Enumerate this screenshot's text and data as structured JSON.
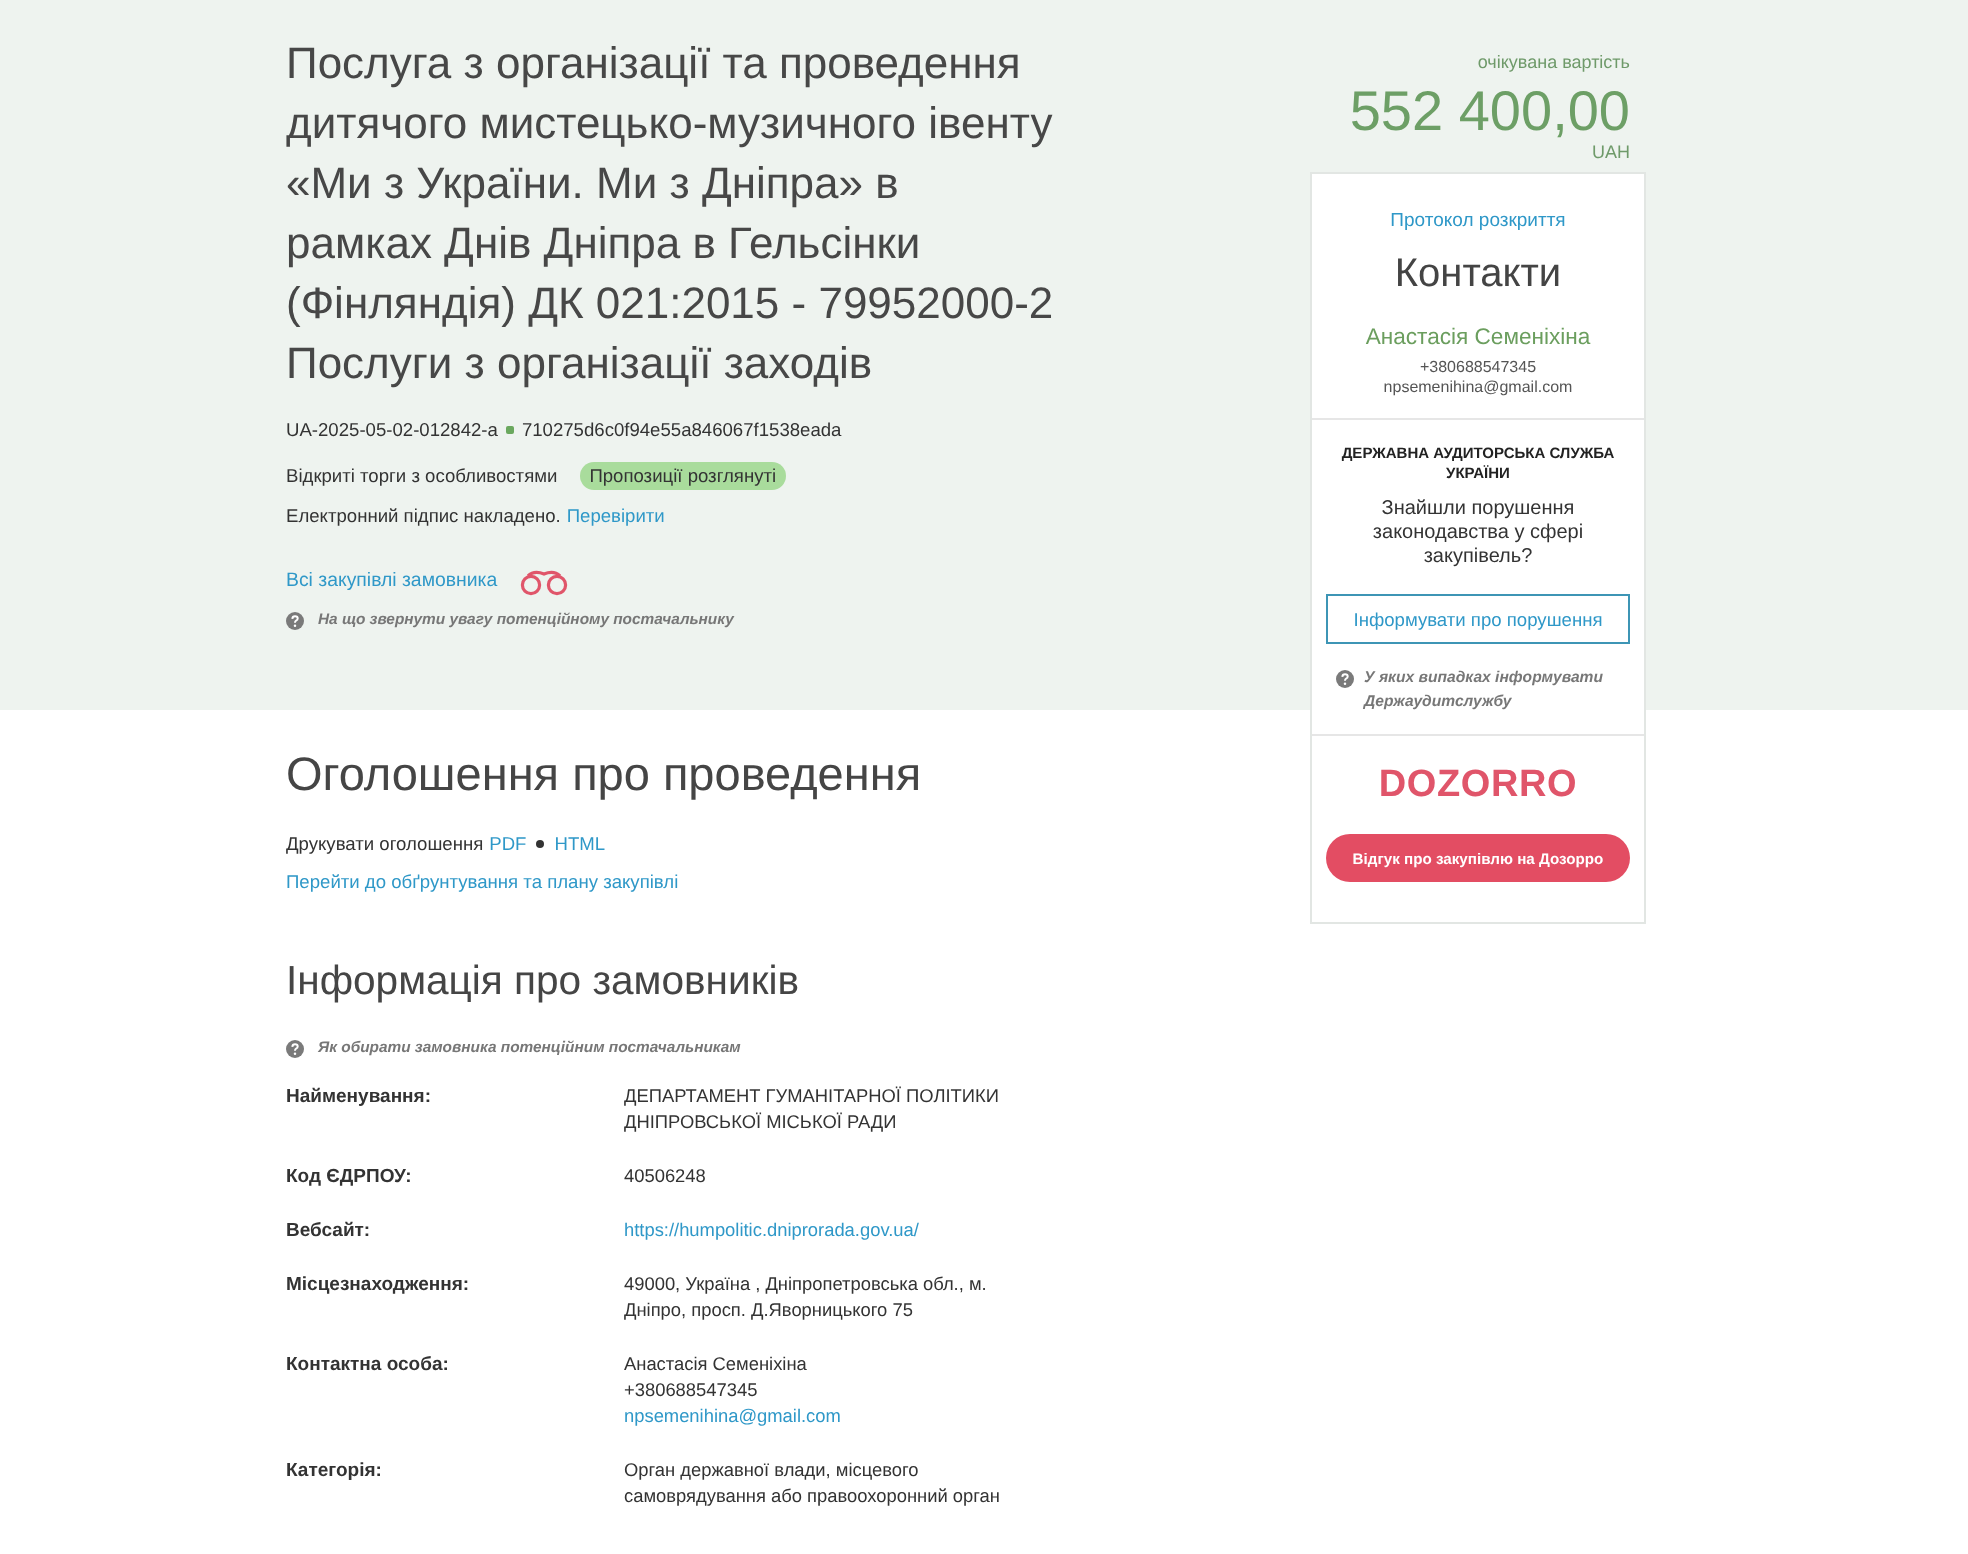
{
  "header": {
    "title": "Послуга з організації та проведення дитячого мистецько-музичного івенту «Ми з України. Ми з Дніпра» в рамках Днів Дніпра в Гельсінки (Фінляндія) ДК 021:2015 - 79952000-2 Послуги з організації заходів",
    "tender_id": "UA-2025-05-02-012842-a",
    "hash": "710275d6c0f94e55a846067f1538eada",
    "procedure": "Відкриті торги з особливостями",
    "status": "Пропозиції розглянуті",
    "signature_text": "Електронний підпис накладено.",
    "signature_link": "Перевірити",
    "buyer_link": "Всі закупівлі замовника",
    "help": "На що звернути увагу потенційному постачальнику"
  },
  "sidebar": {
    "price_label": "очікувана вартість",
    "price": "552 400,00",
    "currency": "UAH",
    "protocol_link": "Протокол розкриття",
    "contacts_title": "Контакти",
    "contact_name": "Анастасія Семеніхіна",
    "contact_phone": "+380688547345",
    "contact_email": "npsemenihina@gmail.com",
    "audit_title": "ДЕРЖАВНА АУДИТОРСЬКА СЛУЖБА УКРАЇНИ",
    "audit_question": "Знайшли порушення законодавства у сфері закупівель?",
    "audit_button": "Інформувати про порушення",
    "audit_help": "У яких випадках інформувати Держаудитслужбу",
    "logo": "DOZORRO",
    "feedback_button": "Відгук про закупівлю на Дозорро"
  },
  "announcement": {
    "title": "Оголошення про проведення",
    "print_label": "Друкувати оголошення",
    "print_links": [
      "PDF",
      "HTML"
    ],
    "plan_link": "Перейти до обґрунтування та плану закупівлі"
  },
  "customers": {
    "title": "Інформація про замовників",
    "help": "Як обирати замовника потенційним постачальникам",
    "rows": [
      {
        "label": "Найменування:",
        "values": [
          {
            "kind": "text",
            "text": "ДЕПАРТАМЕНТ ГУМАНІТАРНОЇ ПОЛІТИКИ ДНІПРОВСЬКОЇ МІСЬКОЇ РАДИ"
          }
        ]
      },
      {
        "label": "Код ЄДРПОУ:",
        "values": [
          {
            "kind": "text",
            "text": "40506248"
          }
        ]
      },
      {
        "label": "Вебсайт:",
        "values": [
          {
            "kind": "link",
            "text": "https://humpolitic.dniprorada.gov.ua/"
          }
        ]
      },
      {
        "label": "Місцезнаходження:",
        "values": [
          {
            "kind": "text",
            "text": "49000, Україна , Дніпропетровська обл., м. Дніпро, просп. Д.Яворницького 75"
          }
        ]
      },
      {
        "label": "Контактна особа:",
        "values": [
          {
            "kind": "text",
            "text": "Анастасія Семеніхіна"
          },
          {
            "kind": "text",
            "text": "+380688547345"
          },
          {
            "kind": "link",
            "text": "npsemenihina@gmail.com"
          }
        ]
      },
      {
        "label": "Категорія:",
        "values": [
          {
            "kind": "text",
            "text": "Орган державної влади, місцевого самоврядування або правоохоронний орган"
          }
        ]
      }
    ]
  }
}
